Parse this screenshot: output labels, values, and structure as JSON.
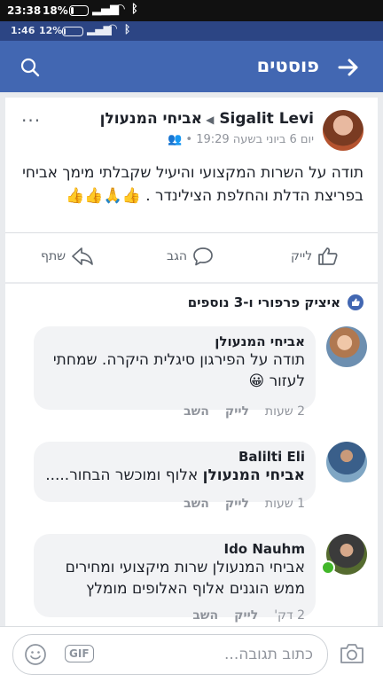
{
  "status_outer": {
    "time": "23:38",
    "battery": "18%"
  },
  "status_inner": {
    "time": "1:46",
    "battery": "12%"
  },
  "appbar": {
    "title": "פוסטים"
  },
  "post": {
    "author": "Sigalit Levi",
    "target": "אביחי המנעולן",
    "meta": "יום 6 ביוני בשעה 19:29 •",
    "menu": "···",
    "body": "תודה על השרות המקצועי והיעיל שקבלתי מימך אביחי בפריצת הדלת והחלפת הצילינדר . 👍🙏👍👍",
    "actions": {
      "like": "לייק",
      "comment": "הגב",
      "share": "שתף"
    }
  },
  "comments_header": "איציק פרפורי ו-3 נוספים",
  "comments": [
    {
      "name": "אביחי המנעולן",
      "text": "תודה על הפירגון סיגלית היקרה. שמחתי לעזור 😀",
      "time": "2 שעות",
      "like": "לייק",
      "reply": "השב"
    },
    {
      "name": "Balilti Eli",
      "text_bold": "אביחי המנעולן",
      "text": "אלוף ומוכשר הבחור.....",
      "time": "1 שעות",
      "like": "לייק",
      "reply": "השב"
    },
    {
      "name": "Ido Nauhm",
      "text": "אביחי המנעולן שרות מיקצועי ומחירים ממש הוגנים אלוף האלופים מומלץ",
      "time": "2 דק'",
      "like": "לייק",
      "reply": "השב"
    }
  ],
  "compose": {
    "placeholder": "כתוב תגובה...",
    "gif": "GIF"
  },
  "colors": {
    "brand": "#4267b2",
    "status_inner": "#2c4584",
    "online": "#42b72a"
  }
}
